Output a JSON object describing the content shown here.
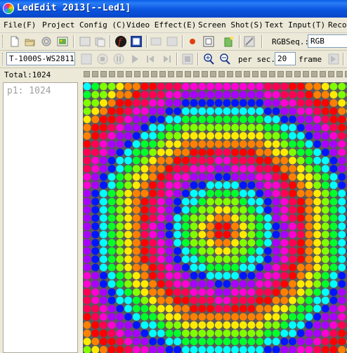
{
  "window": {
    "title": "LedEdit 2013[--Led1]"
  },
  "menu": [
    {
      "label": "File(F)"
    },
    {
      "label": "Project Config (C)"
    },
    {
      "label": "Video Effect(E)"
    },
    {
      "label": "Screen Shot(S)"
    },
    {
      "label": "Text Input(T)"
    },
    {
      "label": "Recor"
    }
  ],
  "toolbar1": {
    "rgbseq_label": "RGBSeq.:",
    "rgbseq_value": "RGB"
  },
  "toolbar2": {
    "controller_value": "T-1000S-WS2811",
    "per_sec_label": "per sec.",
    "fps_value": "20",
    "frame_label": "frame"
  },
  "status": {
    "total_label": "Total:1024"
  },
  "layers": [
    {
      "label": "p1: 1024"
    }
  ],
  "colors": {
    "titlebar": "#0b55e0",
    "led_background": "#5a5a5a"
  },
  "icons": [
    "new-icon",
    "open-icon",
    "settings-icon",
    "image-icon",
    "flash-icon",
    "frame-icon",
    "video-icon",
    "video2-icon",
    "record-icon",
    "window-icon",
    "layers-icon",
    "edit-icon",
    "play-icon",
    "stop-icon",
    "pause-icon",
    "forward-icon",
    "first-icon",
    "last-icon",
    "capture-icon",
    "zoom-in-icon",
    "zoom-out-icon",
    "speed-icon"
  ]
}
